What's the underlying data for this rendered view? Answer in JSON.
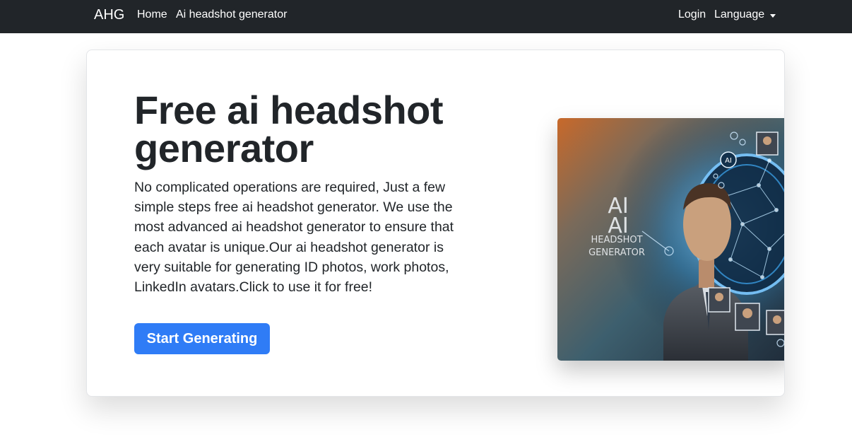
{
  "navbar": {
    "brand": "AHG",
    "links": [
      {
        "label": "Home"
      },
      {
        "label": "Ai headshot generator"
      }
    ],
    "login_label": "Login",
    "language_label": "Language"
  },
  "hero": {
    "title": "Free ai headshot generator",
    "description": "No complicated operations are required, Just a few simple steps free ai headshot generator. We use the most advanced ai headshot generator to ensure that each avatar is unique.Our ai headshot generator is very suitable for generating ID photos, work photos, LinkedIn avatars.Click to use it for free!",
    "cta_label": "Start Generating",
    "image_text": {
      "line1": "AI",
      "line2": "AI",
      "line3": "HEADSHOT",
      "line4": "GENERATOR",
      "badge": "AI"
    }
  },
  "colors": {
    "navbar_bg": "#212529",
    "cta_bg": "#2f7cf6",
    "text": "#212529"
  }
}
